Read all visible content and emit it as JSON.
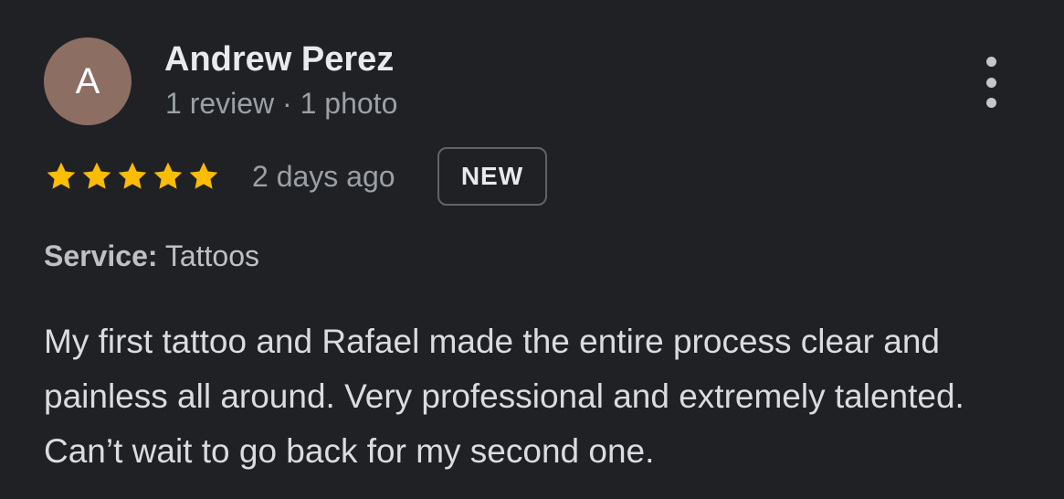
{
  "reviewer": {
    "avatar_letter": "A",
    "name": "Andrew Perez",
    "meta": "1 review · 1 photo"
  },
  "rating": {
    "stars": 5,
    "max": 5,
    "time": "2 days ago",
    "badge": "NEW"
  },
  "service": {
    "label": "Service:",
    "value": "Tattoos"
  },
  "review": {
    "text": "My first tattoo and Rafael made the entire process clear and painless all around. Very professional and extremely talented. Can’t wait to go back for my second one."
  },
  "icons": {
    "more": "more-vert-icon",
    "star": "star-icon"
  },
  "colors": {
    "background": "#202124",
    "star": "#fbbc04",
    "avatar": "#8d6e63"
  }
}
